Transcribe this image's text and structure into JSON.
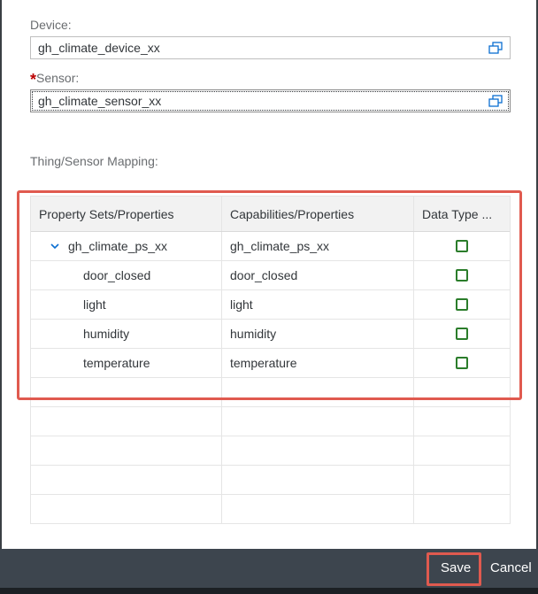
{
  "form": {
    "device_label": "Device:",
    "device_value": "gh_climate_device_xx",
    "sensor_required_marker": "*",
    "sensor_label": "Sensor:",
    "sensor_value": "gh_climate_sensor_xx",
    "value_help_icon": "value-help-icon"
  },
  "mapping": {
    "section_label": "Thing/Sensor Mapping:",
    "columns": [
      "Property Sets/Properties",
      "Capabilities/Properties",
      "Data Type ..."
    ],
    "rows": [
      {
        "property": "gh_climate_ps_xx",
        "capability": "gh_climate_ps_xx",
        "expanded": true,
        "level": 0
      },
      {
        "property": "door_closed",
        "capability": "door_closed",
        "level": 1
      },
      {
        "property": "light",
        "capability": "light",
        "level": 1
      },
      {
        "property": "humidity",
        "capability": "humidity",
        "level": 1
      },
      {
        "property": "temperature",
        "capability": "temperature",
        "level": 1
      }
    ],
    "checkbox_color": "#2b7d2b"
  },
  "footer": {
    "save_label": "Save",
    "cancel_label": "Cancel"
  },
  "colors": {
    "highlight": "#e05a4f",
    "footer_bg": "#3d454e",
    "required": "#bb0000"
  }
}
